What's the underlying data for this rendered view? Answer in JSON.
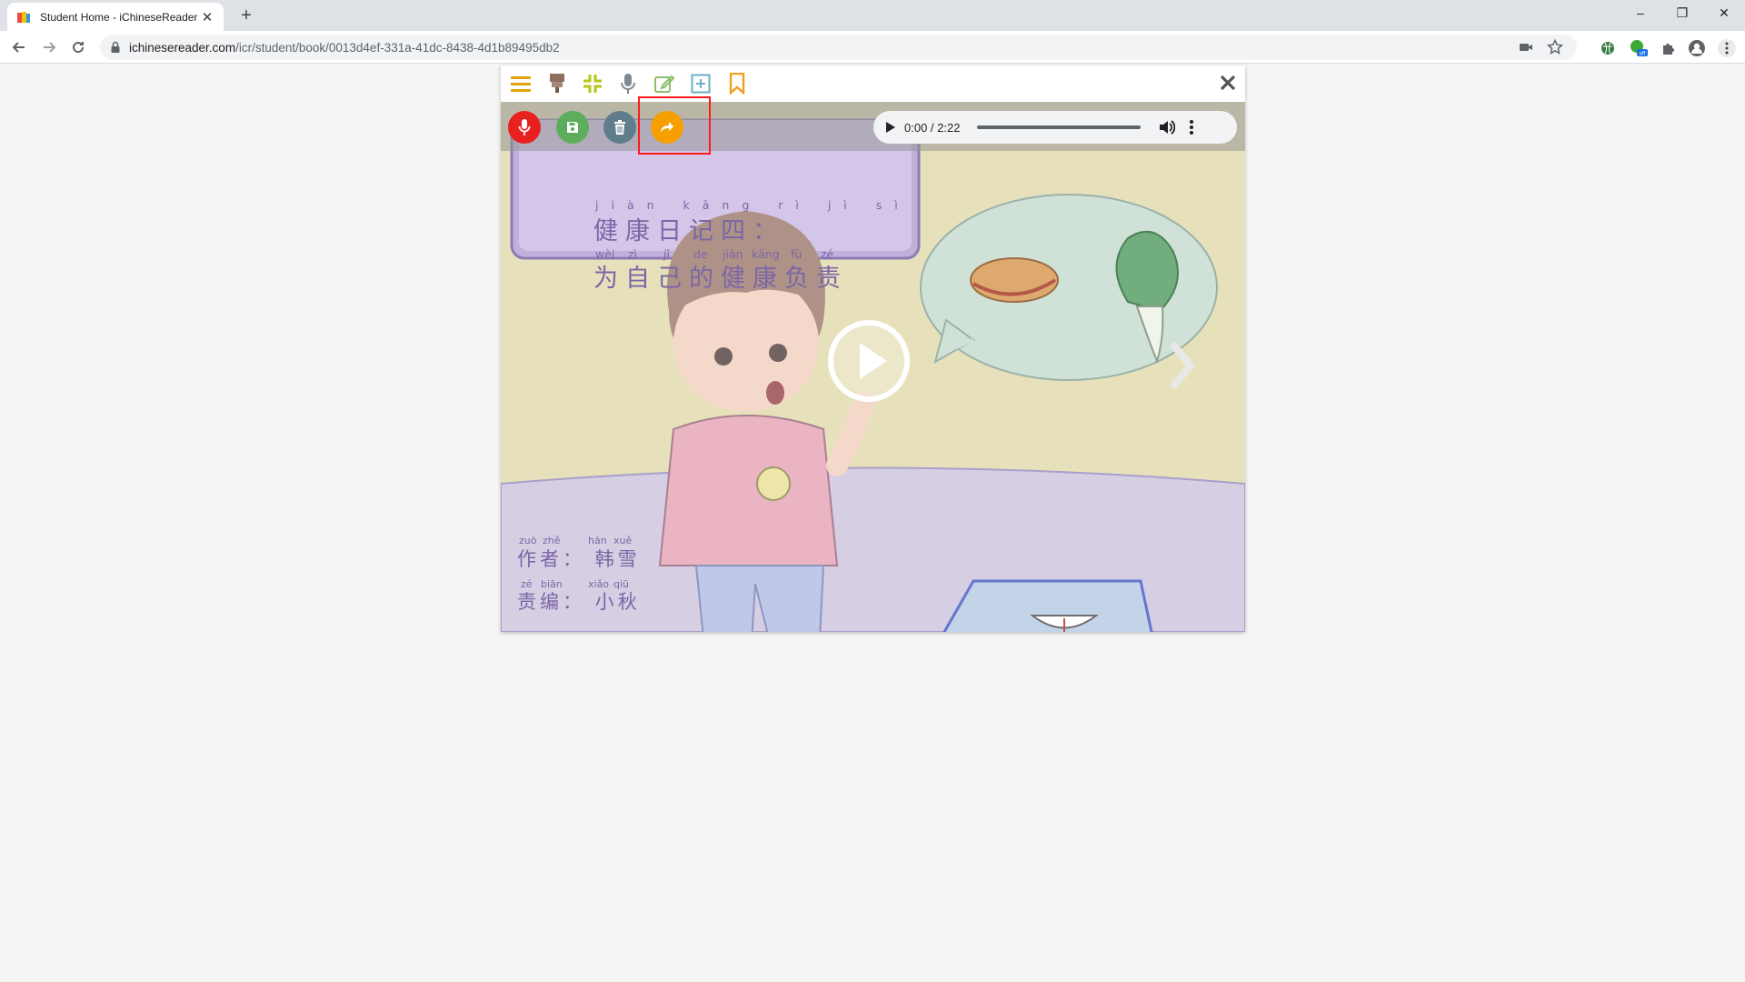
{
  "browser": {
    "tab_title": "Student Home - iChineseReader",
    "url_host": "ichinesereader.com",
    "url_path": "/icr/student/book/0013d4ef-331a-41dc-8438-4d1b89495db2"
  },
  "audio": {
    "time": "0:00 / 2:22"
  },
  "book": {
    "title_pinyin_1": "jiàn kāng rì jì sì",
    "title_line_1": "健康日记四：",
    "title_pinyin_2": [
      "wèi",
      "zì",
      "jǐ",
      "de",
      "jiàn",
      "kāng",
      "fù",
      "zé"
    ],
    "title_line_2": "为自己的健康负责",
    "author_pinyin": [
      "zuò",
      "zhě",
      "hán",
      "xuě"
    ],
    "author_line": "作者：  韩雪",
    "editor_pinyin": [
      "zé",
      "biān",
      "xiǎo",
      "qiū"
    ],
    "editor_line": "责编：  小秋"
  },
  "colors": {
    "record": "#e8211e",
    "save": "#5cae5c",
    "delete": "#5f7d8a",
    "share": "#f5a000",
    "toolbar_gold": "#e3a20a",
    "highlight": "#ff1a1a"
  },
  "icons": {
    "toolbar": [
      "menu-icon",
      "highlighter-icon",
      "shrink-icon",
      "microphone-icon",
      "edit-icon",
      "add-note-icon",
      "bookmark-icon",
      "close-icon"
    ],
    "recording": [
      "record-icon",
      "save-icon",
      "delete-icon",
      "share-icon"
    ]
  }
}
